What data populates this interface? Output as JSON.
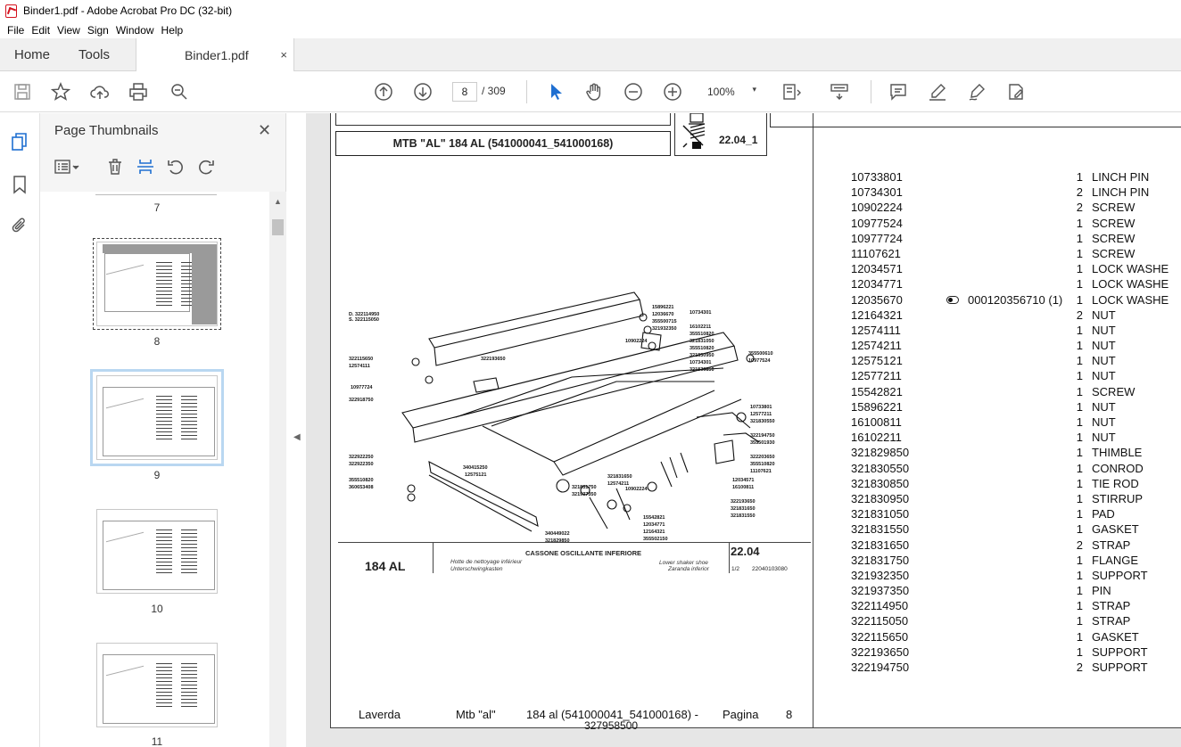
{
  "window": {
    "title": "Binder1.pdf - Adobe Acrobat Pro DC (32-bit)"
  },
  "menu": [
    "File",
    "Edit",
    "View",
    "Sign",
    "Window",
    "Help"
  ],
  "tabs": {
    "home": "Home",
    "tools": "Tools",
    "doc": "Binder1.pdf",
    "close": "×"
  },
  "toolbar": {
    "current_page": "8",
    "page_total": "/ 309",
    "zoom": "100%",
    "zoom_caret": "▾"
  },
  "panel": {
    "title": "Page Thumbnails",
    "close": "✕"
  },
  "thumbnails": [
    {
      "label": "7"
    },
    {
      "label": "8"
    },
    {
      "label": "9"
    },
    {
      "label": "10"
    },
    {
      "label": "11"
    }
  ],
  "doc": {
    "header_title": "MTB \"AL\" 184 AL (541000041_541000168)",
    "header_code": "22.04_1",
    "caption": {
      "model": "184 AL",
      "title": "CASSONE OSCILLANTE INFERIORE",
      "fr": "Hotte de nettoyage inférieur",
      "de": "Unterschwingkasten",
      "en": "Lower shaker shoe",
      "es": "Zaranda inferior",
      "number": "22.04",
      "fraction": "1/2",
      "ref": "22040103080"
    },
    "footer": {
      "brand": "Laverda",
      "model": "Mtb \"al\"",
      "variant": "184 al (541000041_541000168)  -",
      "serial": "327958500",
      "page_label": "Pagina",
      "page_num": "8"
    },
    "drawing_labels": [
      "15896221",
      "12036670",
      "355500715",
      "321932350",
      "10734301",
      "16102211",
      "355510820",
      "321831050",
      "355510820",
      "321830950",
      "10902224",
      "10734301",
      "321830850",
      "355500610",
      "10977524",
      "D. 322114950",
      "S. 322115050",
      "322115650",
      "12574111",
      "322193650",
      "10977724",
      "322918750",
      "10733801",
      "12577211",
      "321830550",
      "322194750",
      "355501930",
      "322922250",
      "322922350",
      "340415250",
      "12575121",
      "321831650",
      "12574211",
      "322203650",
      "355510820",
      "11107621",
      "12034571",
      "16100811",
      "355510820",
      "360653408",
      "321831750",
      "321937350",
      "10902224",
      "322193650",
      "321831650",
      "321831550",
      "15542821",
      "12034771",
      "12164321",
      "355502150",
      "340449022",
      "321829850"
    ],
    "parts": [
      {
        "pn": "10733801",
        "qty": "1",
        "desc": "LINCH PIN"
      },
      {
        "pn": "10734301",
        "qty": "2",
        "desc": "LINCH PIN"
      },
      {
        "pn": "10902224",
        "qty": "2",
        "desc": "SCREW"
      },
      {
        "pn": "10977524",
        "qty": "1",
        "desc": "SCREW"
      },
      {
        "pn": "10977724",
        "qty": "1",
        "desc": "SCREW"
      },
      {
        "pn": "11107621",
        "qty": "1",
        "desc": "SCREW"
      },
      {
        "pn": "12034571",
        "qty": "1",
        "desc": "LOCK WASHE"
      },
      {
        "pn": "12034771",
        "qty": "1",
        "desc": "LOCK WASHE"
      },
      {
        "pn": "12035670",
        "qty": "1",
        "desc": "LOCK WASHE",
        "ext": "000120356710  (1)"
      },
      {
        "pn": "12164321",
        "qty": "2",
        "desc": "NUT"
      },
      {
        "pn": "12574111",
        "qty": "1",
        "desc": "NUT"
      },
      {
        "pn": "12574211",
        "qty": "1",
        "desc": "NUT"
      },
      {
        "pn": "12575121",
        "qty": "1",
        "desc": "NUT"
      },
      {
        "pn": "12577211",
        "qty": "1",
        "desc": "NUT"
      },
      {
        "pn": "15542821",
        "qty": "1",
        "desc": "SCREW"
      },
      {
        "pn": "15896221",
        "qty": "1",
        "desc": "NUT"
      },
      {
        "pn": "16100811",
        "qty": "1",
        "desc": "NUT"
      },
      {
        "pn": "16102211",
        "qty": "1",
        "desc": "NUT"
      },
      {
        "pn": "321829850",
        "qty": "1",
        "desc": "THIMBLE"
      },
      {
        "pn": "321830550",
        "qty": "1",
        "desc": "CONROD"
      },
      {
        "pn": "321830850",
        "qty": "1",
        "desc": "TIE ROD"
      },
      {
        "pn": "321830950",
        "qty": "1",
        "desc": "STIRRUP"
      },
      {
        "pn": "321831050",
        "qty": "1",
        "desc": "PAD"
      },
      {
        "pn": "321831550",
        "qty": "1",
        "desc": "GASKET"
      },
      {
        "pn": "321831650",
        "qty": "2",
        "desc": "STRAP"
      },
      {
        "pn": "321831750",
        "qty": "1",
        "desc": "FLANGE"
      },
      {
        "pn": "321932350",
        "qty": "1",
        "desc": "SUPPORT"
      },
      {
        "pn": "321937350",
        "qty": "1",
        "desc": "PIN"
      },
      {
        "pn": "322114950",
        "qty": "1",
        "desc": "STRAP"
      },
      {
        "pn": "322115050",
        "qty": "1",
        "desc": "STRAP"
      },
      {
        "pn": "322115650",
        "qty": "1",
        "desc": "GASKET"
      },
      {
        "pn": "322193650",
        "qty": "1",
        "desc": "SUPPORT"
      },
      {
        "pn": "322194750",
        "qty": "2",
        "desc": "SUPPORT"
      }
    ]
  }
}
